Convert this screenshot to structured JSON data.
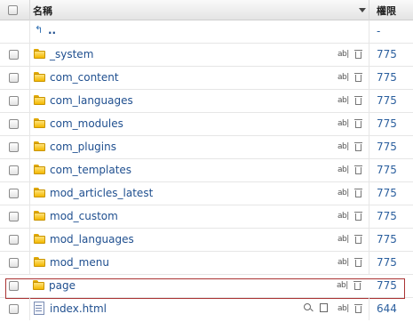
{
  "header": {
    "name_label": "名稱",
    "permission_label": "權限"
  },
  "up_row": {
    "icon": "up-arrow-icon",
    "label": "..",
    "permission": "-"
  },
  "rows": [
    {
      "name": "_system",
      "type": "folder",
      "permission": "775"
    },
    {
      "name": "com_content",
      "type": "folder",
      "permission": "775"
    },
    {
      "name": "com_languages",
      "type": "folder",
      "permission": "775"
    },
    {
      "name": "com_modules",
      "type": "folder",
      "permission": "775"
    },
    {
      "name": "com_plugins",
      "type": "folder",
      "permission": "775"
    },
    {
      "name": "com_templates",
      "type": "folder",
      "permission": "775"
    },
    {
      "name": "mod_articles_latest",
      "type": "folder",
      "permission": "775"
    },
    {
      "name": "mod_custom",
      "type": "folder",
      "permission": "775"
    },
    {
      "name": "mod_languages",
      "type": "folder",
      "permission": "775"
    },
    {
      "name": "mod_menu",
      "type": "folder",
      "permission": "775"
    },
    {
      "name": "page",
      "type": "folder",
      "permission": "775",
      "selected": true
    },
    {
      "name": "index.html",
      "type": "file",
      "permission": "644"
    }
  ],
  "actions": {
    "rename_label": "ab|"
  },
  "colors": {
    "link": "#1f4f8f",
    "permission": "#2b5f9e",
    "selection_border": "#aa3333",
    "folder": "#f3b800"
  }
}
